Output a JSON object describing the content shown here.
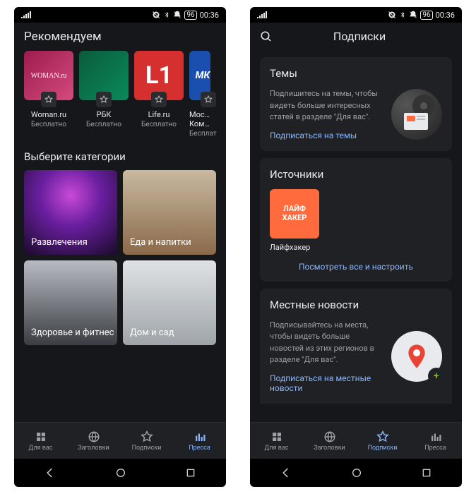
{
  "status": {
    "time": "00:36",
    "battery": "96"
  },
  "left": {
    "recommend_title": "Рекомендуем",
    "cards": [
      {
        "name": "Woman.ru",
        "free": "Бесплатно",
        "logo_text": "WOMAN.ru"
      },
      {
        "name": "РБК",
        "free": "Бесплатно",
        "logo_text": ""
      },
      {
        "name": "Life.ru",
        "free": "Бесплатно",
        "logo_text": "L1"
      },
      {
        "name": "Московский Комсомолец",
        "free": "Бесплатно",
        "logo_text": "МК"
      }
    ],
    "categories_title": "Выберите категории",
    "categories": [
      {
        "label": "Развлечения"
      },
      {
        "label": "Еда и напитки"
      },
      {
        "label": "Здоровье и фитнес"
      },
      {
        "label": "Дом и сад"
      }
    ]
  },
  "right": {
    "header_title": "Подписки",
    "topics": {
      "title": "Темы",
      "body": "Подпишитесь на темы, чтобы видеть больше интересных статей в разделе \"Для вас\".",
      "link": "Подписаться на темы"
    },
    "sources": {
      "title": "Источники",
      "items": [
        {
          "name": "Лайфхакер",
          "logo_text": "ЛАЙФ\nХАКЕР"
        }
      ],
      "link": "Посмотреть все и настроить"
    },
    "local": {
      "title": "Местные новости",
      "body": "Подписывайтесь на места, чтобы видеть больше новостей из этих регионов в разделе \"Для вас\".",
      "link": "Подписаться на местные новости"
    }
  },
  "nav": {
    "for_you": "Для вас",
    "headlines": "Заголовки",
    "subscriptions": "Подписки",
    "press": "Пресса"
  }
}
